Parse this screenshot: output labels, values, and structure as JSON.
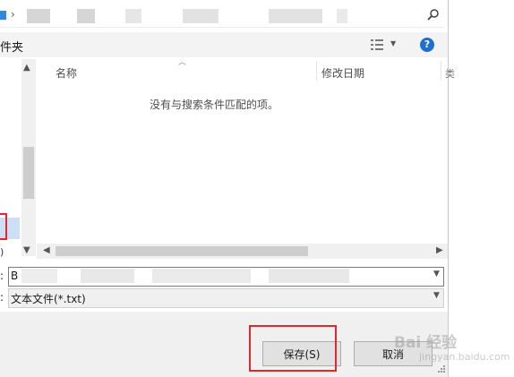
{
  "toolbar": {
    "label": "件夹"
  },
  "columns": {
    "name": "名称",
    "modified": "修改日期",
    "partial": "类"
  },
  "list": {
    "empty_message": "没有与搜索条件匹配的项。"
  },
  "nav": {
    "partial_text": ")"
  },
  "form": {
    "filename_label": ":",
    "filename_value": "B",
    "filetype_label": ":",
    "filetype_value": "文本文件(*.txt)"
  },
  "buttons": {
    "save": "保存(S)",
    "cancel": "取消"
  },
  "watermark": {
    "brand": "Bai 经验",
    "sub": "jingyan.baidu.com"
  },
  "colors": {
    "highlight_red": "#e0292f",
    "help_blue": "#1e6fd0",
    "accent_blue": "#2f88d8"
  },
  "icons": {
    "search": "search-icon",
    "view": "view-options-icon",
    "help": "help-icon"
  }
}
